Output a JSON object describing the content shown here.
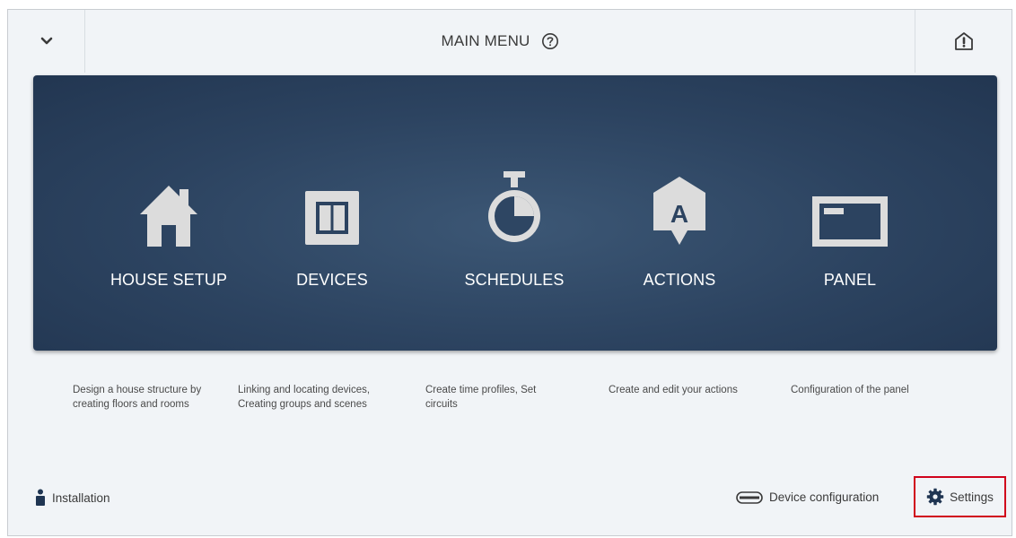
{
  "header": {
    "title": "MAIN MENU",
    "left_icon": "chevron-down-icon",
    "help_icon": "help-circle-icon",
    "right_icon": "house-alert-icon"
  },
  "tiles": [
    {
      "label": "HOUSE SETUP",
      "icon": "house-icon",
      "description_line1": "Design a house structure by",
      "description_line2": "creating floors and rooms"
    },
    {
      "label": "DEVICES",
      "icon": "switch-panel-icon",
      "description_line1": "Linking and locating devices,",
      "description_line2": "Creating groups and scenes"
    },
    {
      "label": "SCHEDULES",
      "icon": "stopwatch-icon",
      "description_line1": "Create time profiles, Set",
      "description_line2": "circuits"
    },
    {
      "label": "ACTIONS",
      "icon": "action-tag-icon",
      "description_line1": "Create and edit your actions",
      "description_line2": ""
    },
    {
      "label": "PANEL",
      "icon": "panel-icon",
      "description_line1": "Configuration of the panel",
      "description_line2": ""
    }
  ],
  "footer": {
    "installation_label": "Installation",
    "device_configuration_label": "Device configuration",
    "settings_label": "Settings"
  },
  "colors": {
    "panel_bg": "#2c4360",
    "highlight": "#d0021b",
    "icon_fill": "#dcdcdc"
  }
}
